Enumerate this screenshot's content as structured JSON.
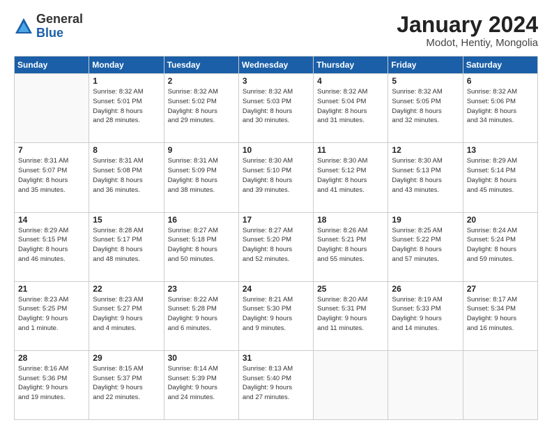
{
  "logo": {
    "general": "General",
    "blue": "Blue"
  },
  "title": "January 2024",
  "subtitle": "Modot, Hentiy, Mongolia",
  "weekdays": [
    "Sunday",
    "Monday",
    "Tuesday",
    "Wednesday",
    "Thursday",
    "Friday",
    "Saturday"
  ],
  "weeks": [
    [
      {
        "num": "",
        "info": ""
      },
      {
        "num": "1",
        "info": "Sunrise: 8:32 AM\nSunset: 5:01 PM\nDaylight: 8 hours\nand 28 minutes."
      },
      {
        "num": "2",
        "info": "Sunrise: 8:32 AM\nSunset: 5:02 PM\nDaylight: 8 hours\nand 29 minutes."
      },
      {
        "num": "3",
        "info": "Sunrise: 8:32 AM\nSunset: 5:03 PM\nDaylight: 8 hours\nand 30 minutes."
      },
      {
        "num": "4",
        "info": "Sunrise: 8:32 AM\nSunset: 5:04 PM\nDaylight: 8 hours\nand 31 minutes."
      },
      {
        "num": "5",
        "info": "Sunrise: 8:32 AM\nSunset: 5:05 PM\nDaylight: 8 hours\nand 32 minutes."
      },
      {
        "num": "6",
        "info": "Sunrise: 8:32 AM\nSunset: 5:06 PM\nDaylight: 8 hours\nand 34 minutes."
      }
    ],
    [
      {
        "num": "7",
        "info": "Sunrise: 8:31 AM\nSunset: 5:07 PM\nDaylight: 8 hours\nand 35 minutes."
      },
      {
        "num": "8",
        "info": "Sunrise: 8:31 AM\nSunset: 5:08 PM\nDaylight: 8 hours\nand 36 minutes."
      },
      {
        "num": "9",
        "info": "Sunrise: 8:31 AM\nSunset: 5:09 PM\nDaylight: 8 hours\nand 38 minutes."
      },
      {
        "num": "10",
        "info": "Sunrise: 8:30 AM\nSunset: 5:10 PM\nDaylight: 8 hours\nand 39 minutes."
      },
      {
        "num": "11",
        "info": "Sunrise: 8:30 AM\nSunset: 5:12 PM\nDaylight: 8 hours\nand 41 minutes."
      },
      {
        "num": "12",
        "info": "Sunrise: 8:30 AM\nSunset: 5:13 PM\nDaylight: 8 hours\nand 43 minutes."
      },
      {
        "num": "13",
        "info": "Sunrise: 8:29 AM\nSunset: 5:14 PM\nDaylight: 8 hours\nand 45 minutes."
      }
    ],
    [
      {
        "num": "14",
        "info": "Sunrise: 8:29 AM\nSunset: 5:15 PM\nDaylight: 8 hours\nand 46 minutes."
      },
      {
        "num": "15",
        "info": "Sunrise: 8:28 AM\nSunset: 5:17 PM\nDaylight: 8 hours\nand 48 minutes."
      },
      {
        "num": "16",
        "info": "Sunrise: 8:27 AM\nSunset: 5:18 PM\nDaylight: 8 hours\nand 50 minutes."
      },
      {
        "num": "17",
        "info": "Sunrise: 8:27 AM\nSunset: 5:20 PM\nDaylight: 8 hours\nand 52 minutes."
      },
      {
        "num": "18",
        "info": "Sunrise: 8:26 AM\nSunset: 5:21 PM\nDaylight: 8 hours\nand 55 minutes."
      },
      {
        "num": "19",
        "info": "Sunrise: 8:25 AM\nSunset: 5:22 PM\nDaylight: 8 hours\nand 57 minutes."
      },
      {
        "num": "20",
        "info": "Sunrise: 8:24 AM\nSunset: 5:24 PM\nDaylight: 8 hours\nand 59 minutes."
      }
    ],
    [
      {
        "num": "21",
        "info": "Sunrise: 8:23 AM\nSunset: 5:25 PM\nDaylight: 9 hours\nand 1 minute."
      },
      {
        "num": "22",
        "info": "Sunrise: 8:23 AM\nSunset: 5:27 PM\nDaylight: 9 hours\nand 4 minutes."
      },
      {
        "num": "23",
        "info": "Sunrise: 8:22 AM\nSunset: 5:28 PM\nDaylight: 9 hours\nand 6 minutes."
      },
      {
        "num": "24",
        "info": "Sunrise: 8:21 AM\nSunset: 5:30 PM\nDaylight: 9 hours\nand 9 minutes."
      },
      {
        "num": "25",
        "info": "Sunrise: 8:20 AM\nSunset: 5:31 PM\nDaylight: 9 hours\nand 11 minutes."
      },
      {
        "num": "26",
        "info": "Sunrise: 8:19 AM\nSunset: 5:33 PM\nDaylight: 9 hours\nand 14 minutes."
      },
      {
        "num": "27",
        "info": "Sunrise: 8:17 AM\nSunset: 5:34 PM\nDaylight: 9 hours\nand 16 minutes."
      }
    ],
    [
      {
        "num": "28",
        "info": "Sunrise: 8:16 AM\nSunset: 5:36 PM\nDaylight: 9 hours\nand 19 minutes."
      },
      {
        "num": "29",
        "info": "Sunrise: 8:15 AM\nSunset: 5:37 PM\nDaylight: 9 hours\nand 22 minutes."
      },
      {
        "num": "30",
        "info": "Sunrise: 8:14 AM\nSunset: 5:39 PM\nDaylight: 9 hours\nand 24 minutes."
      },
      {
        "num": "31",
        "info": "Sunrise: 8:13 AM\nSunset: 5:40 PM\nDaylight: 9 hours\nand 27 minutes."
      },
      {
        "num": "",
        "info": ""
      },
      {
        "num": "",
        "info": ""
      },
      {
        "num": "",
        "info": ""
      }
    ]
  ]
}
